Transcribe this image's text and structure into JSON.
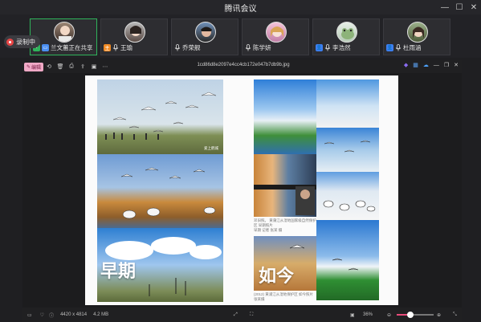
{
  "window": {
    "title": "腾讯会议"
  },
  "participants": [
    {
      "name": "兰文蕙正在共享",
      "active": true,
      "badge": "share"
    },
    {
      "name": "王瑜",
      "active": false,
      "badge": "host"
    },
    {
      "name": "乔荣舰",
      "active": false,
      "badge": ""
    },
    {
      "name": "陈学妍",
      "active": false,
      "badge": ""
    },
    {
      "name": "李浩然",
      "active": false,
      "badge": "user"
    },
    {
      "name": "杜雨涵",
      "active": false,
      "badge": "user"
    }
  ],
  "recording": {
    "label": "录制中"
  },
  "viewer": {
    "edit_label": "编辑",
    "filename": "1cd86d8e2097e4cc4cb172e047b7db9b.jpg",
    "info_left": "4420 x 4814",
    "info_size": "4.2 MB",
    "zoom": "36%",
    "zoom_level": 0.36
  },
  "document": {
    "left_word": "早期",
    "right_word": "如今",
    "watermark": "爱上鹤城",
    "caption_mid": "邓旧照。 黄蒲江从湿地国家级自然保护区 早期照片",
    "caption_mid_credit": "早期 记者 张某 摄",
    "caption_bottom": "(2012) 黄浦江从湿地保护区 如今照片 张某摄"
  },
  "colors": {
    "accent": "#2fb35b",
    "record": "#e84646",
    "edit": "#f0a9c6"
  }
}
